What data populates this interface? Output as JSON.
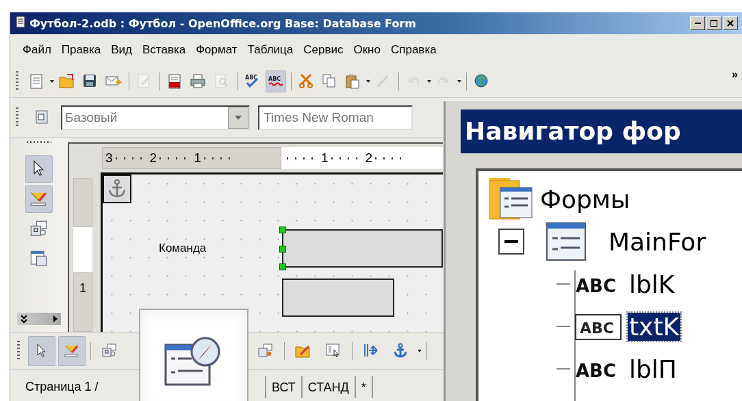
{
  "window": {
    "title": "Футбол-2.odb : Футбол - OpenOffice.org Base: Database Form"
  },
  "menu": [
    "Файл",
    "Правка",
    "Вид",
    "Вставка",
    "Формат",
    "Таблица",
    "Сервис",
    "Окно",
    "Справка"
  ],
  "toolbar": {
    "items": [
      {
        "kind": "button",
        "on": false,
        "disabled": false
      },
      {
        "kind": "caret"
      },
      {
        "kind": "button",
        "on": false,
        "disabled": false
      },
      {
        "kind": "button",
        "on": false,
        "disabled": false
      },
      {
        "kind": "button",
        "on": false,
        "disabled": false
      },
      {
        "kind": "separator"
      },
      {
        "kind": "button",
        "on": false,
        "disabled": true
      },
      {
        "kind": "separator"
      },
      {
        "kind": "button",
        "on": false,
        "disabled": false
      },
      {
        "kind": "button",
        "on": false,
        "disabled": false
      },
      {
        "kind": "button",
        "on": false,
        "disabled": true
      },
      {
        "kind": "separator"
      },
      {
        "kind": "button",
        "on": false,
        "disabled": false,
        "text": "ABC"
      },
      {
        "kind": "button",
        "on": true,
        "disabled": false,
        "text": "ABC"
      },
      {
        "kind": "separator"
      },
      {
        "kind": "button",
        "on": false,
        "disabled": false
      },
      {
        "kind": "button",
        "on": false,
        "disabled": false
      },
      {
        "kind": "button",
        "on": false,
        "disabled": false
      },
      {
        "kind": "caret"
      },
      {
        "kind": "button",
        "on": false,
        "disabled": true
      },
      {
        "kind": "separator"
      },
      {
        "kind": "button",
        "on": false,
        "disabled": true
      },
      {
        "kind": "caret"
      },
      {
        "kind": "button",
        "on": false,
        "disabled": true
      },
      {
        "kind": "caret"
      },
      {
        "kind": "separator"
      },
      {
        "kind": "button",
        "on": false,
        "disabled": false
      }
    ],
    "overflow": "»"
  },
  "format_bar": {
    "style": "Базовый",
    "font": "Times New Roman"
  },
  "design_bar": [
    {
      "kind": "button",
      "on": true
    },
    {
      "kind": "button",
      "on": true
    },
    {
      "kind": "button",
      "on": false
    },
    {
      "kind": "button",
      "on": false
    }
  ],
  "ruler": {
    "left_numbers": [
      "3",
      "2",
      "1"
    ],
    "right_numbers": [
      "1",
      "2"
    ],
    "vertical_number": "1"
  },
  "form": {
    "label": "Команда"
  },
  "bottom_bar": [
    {
      "kind": "button",
      "on": true
    },
    {
      "kind": "button",
      "on": true
    },
    {
      "kind": "separator"
    },
    {
      "kind": "button",
      "on": false
    },
    {
      "kind": "spacer"
    },
    {
      "kind": "button",
      "on": false
    },
    {
      "kind": "separator"
    },
    {
      "kind": "button",
      "on": false
    },
    {
      "kind": "button",
      "on": false
    },
    {
      "kind": "separator"
    },
    {
      "kind": "button",
      "on": false
    },
    {
      "kind": "button",
      "on": false
    },
    {
      "kind": "caret"
    },
    {
      "kind": "separator"
    }
  ],
  "status_bar": {
    "page": "Страница 1 /",
    "cells": [
      "ВСТ",
      "СТАНД",
      "*",
      ""
    ]
  },
  "navigator": {
    "title": "Навигатор фор",
    "tree": [
      {
        "label": "Формы",
        "selected": false,
        "children": [
          {
            "label": "MainFor",
            "selected": false,
            "expanded": true,
            "children": [
              {
                "label": "lblK",
                "kind": "label",
                "icon_text": "ABC",
                "selected": false
              },
              {
                "label": "txtK",
                "kind": "textbox",
                "icon_text": "ABC",
                "selected": true
              },
              {
                "label": "lblП",
                "kind": "label",
                "icon_text": "ABC",
                "selected": false
              }
            ]
          }
        ]
      }
    ]
  }
}
